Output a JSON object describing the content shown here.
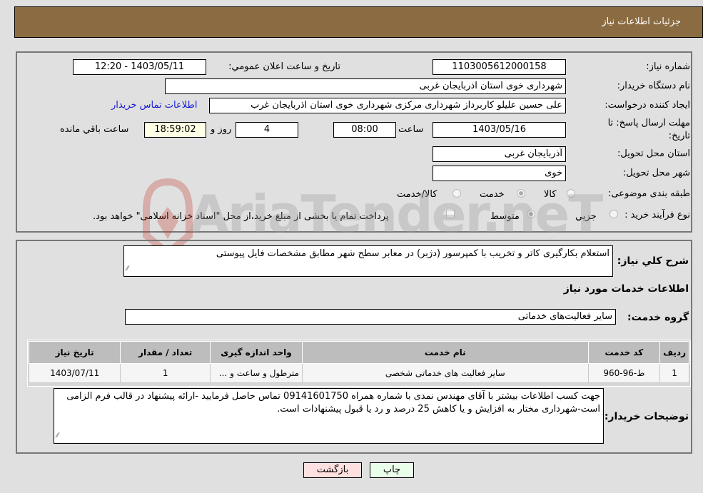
{
  "header": {
    "title": "جزئیات اطلاعات نیاز"
  },
  "form": {
    "need_number_label": "شماره نیاز:",
    "need_number": "1103005612000158",
    "announce_label": "تاریخ و ساعت اعلان عمومي:",
    "announce_value": "1403/05/11 - 12:20",
    "buyer_org_label": "نام دستگاه خریدار:",
    "buyer_org": "شهرداری خوی استان اذربایجان غربی",
    "creator_label": "ایجاد کننده درخواست:",
    "creator": "علی حسین علیلو کاربرداز شهرداری مرکزی شهرداری خوی استان اذربایجان غرب",
    "contact_link": "اطلاعات تماس خریدار",
    "deadline_label_1": "مهلت ارسال پاسخ: تا",
    "deadline_label_2": "تاریخ:",
    "deadline_date": "1403/05/16",
    "time_label": "ساعت",
    "deadline_time": "08:00",
    "days_value": "4",
    "days_label": "روز و",
    "remaining_time": "18:59:02",
    "remaining_label": "ساعت باقي مانده",
    "province_label": "استان محل تحویل:",
    "province": "آذربایجان غربی",
    "city_label": "شهر محل تحویل:",
    "city": "خوی",
    "category_label": "طبقه بندی موضوعی:",
    "category_options": [
      {
        "label": "کالا",
        "selected": false
      },
      {
        "label": "خدمت",
        "selected": true
      },
      {
        "label": "کالا/خدمت",
        "selected": false
      }
    ],
    "process_label": "نوع فرآیند خرید :",
    "process_options": [
      {
        "label": "جزيي",
        "selected": false
      },
      {
        "label": "متوسط",
        "selected": true
      }
    ],
    "treasury_note": "پرداخت تمام یا بخشی از مبلغ خرید،از محل \"اسناد خزانه اسلامی\" خواهد بود."
  },
  "details": {
    "summary_label": "شرح کلي نياز:",
    "summary": "استعلام بکارگیری کاتر و تخریب با کمپرسور (دژبر) در معابر سطح شهر مطابق مشخصات فایل پیوستی",
    "services_heading": "اطلاعات خدمات مورد نياز",
    "service_group_label": "گروه خدمت:",
    "service_group": "سایر فعالیت‌های خدماتی",
    "table": {
      "headers": [
        "رديف",
        "کد خدمت",
        "نام خدمت",
        "واحد اندازه گیری",
        "تعداد / مقدار",
        "تاریخ نیاز"
      ],
      "rows": [
        [
          "1",
          "ط-96-960",
          "سایر فعالیت های خدماتی شخصی",
          "مترطول و ساعت و ...",
          "1",
          "1403/07/11"
        ]
      ]
    },
    "buyer_notes_label": "توضیحات خریدار:",
    "buyer_notes": "جهت کسب اطلاعات بیشتر با آقای مهندس نمدی با شماره همراه 09141601750 تماس حاصل فرمایید -ارائه پیشنهاد در قالب فرم الزامی است-شهرداری مختار به افزایش و یا کاهش 25 درصد و رد یا قبول پیشنهادات است."
  },
  "buttons": {
    "print": "چاپ",
    "back": "بازگشت"
  },
  "watermark": {
    "text": "AriaTender.neT"
  }
}
